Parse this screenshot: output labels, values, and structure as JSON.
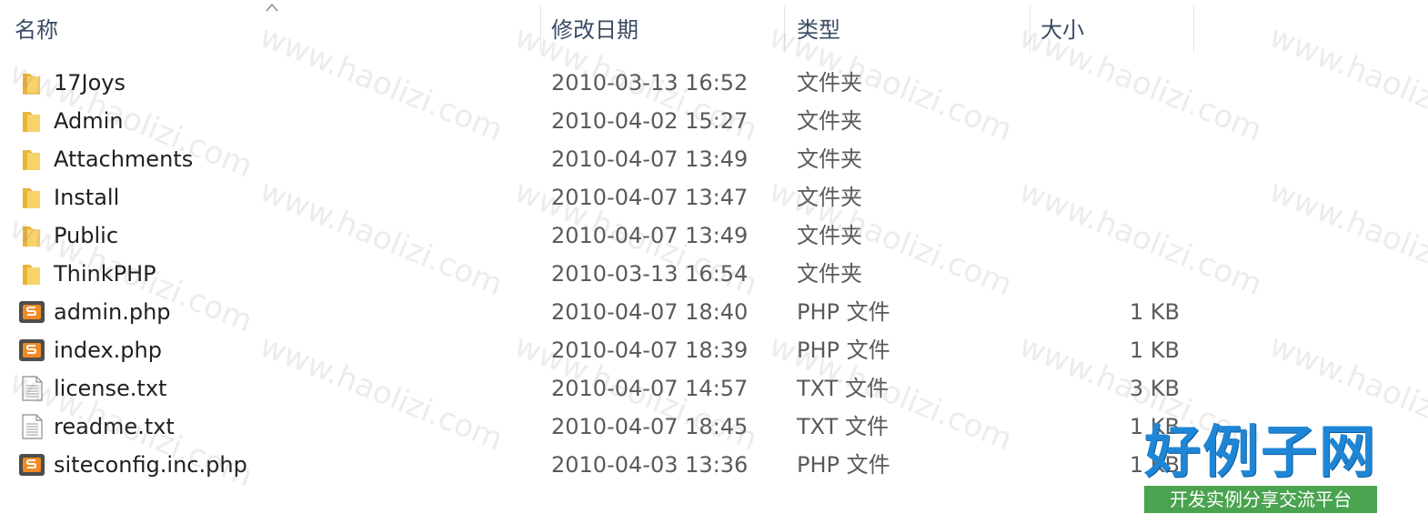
{
  "columns": {
    "name": "名称",
    "modified": "修改日期",
    "type": "类型",
    "size": "大小"
  },
  "files": [
    {
      "name": "17Joys",
      "modified": "2010-03-13 16:52",
      "type": "文件夹",
      "size": "",
      "icon": "folder-icon"
    },
    {
      "name": "Admin",
      "modified": "2010-04-02 15:27",
      "type": "文件夹",
      "size": "",
      "icon": "folder-icon"
    },
    {
      "name": "Attachments",
      "modified": "2010-04-07 13:49",
      "type": "文件夹",
      "size": "",
      "icon": "folder-icon"
    },
    {
      "name": "Install",
      "modified": "2010-04-07 13:47",
      "type": "文件夹",
      "size": "",
      "icon": "folder-icon"
    },
    {
      "name": "Public",
      "modified": "2010-04-07 13:49",
      "type": "文件夹",
      "size": "",
      "icon": "folder-icon"
    },
    {
      "name": "ThinkPHP",
      "modified": "2010-03-13 16:54",
      "type": "文件夹",
      "size": "",
      "icon": "folder-icon"
    },
    {
      "name": "admin.php",
      "modified": "2010-04-07 18:40",
      "type": "PHP 文件",
      "size": "1 KB",
      "icon": "php-file-icon"
    },
    {
      "name": "index.php",
      "modified": "2010-04-07 18:39",
      "type": "PHP 文件",
      "size": "1 KB",
      "icon": "php-file-icon"
    },
    {
      "name": "license.txt",
      "modified": "2010-04-07 14:57",
      "type": "TXT 文件",
      "size": "3 KB",
      "icon": "text-file-icon"
    },
    {
      "name": "readme.txt",
      "modified": "2010-04-07 18:45",
      "type": "TXT 文件",
      "size": "1 KB",
      "icon": "text-file-icon"
    },
    {
      "name": "siteconfig.inc.php",
      "modified": "2010-04-03 13:36",
      "type": "PHP 文件",
      "size": "1 KB",
      "icon": "php-file-icon"
    }
  ],
  "watermark": {
    "text": "www.haolizi.com",
    "logo_title": "好例子网",
    "logo_subtitle": "开发实例分享交流平台"
  },
  "colors": {
    "header_text": "#3b4b66",
    "folder": "#f5c44c",
    "logo_blue": "#1f86d6",
    "logo_green": "#4aa34f"
  }
}
